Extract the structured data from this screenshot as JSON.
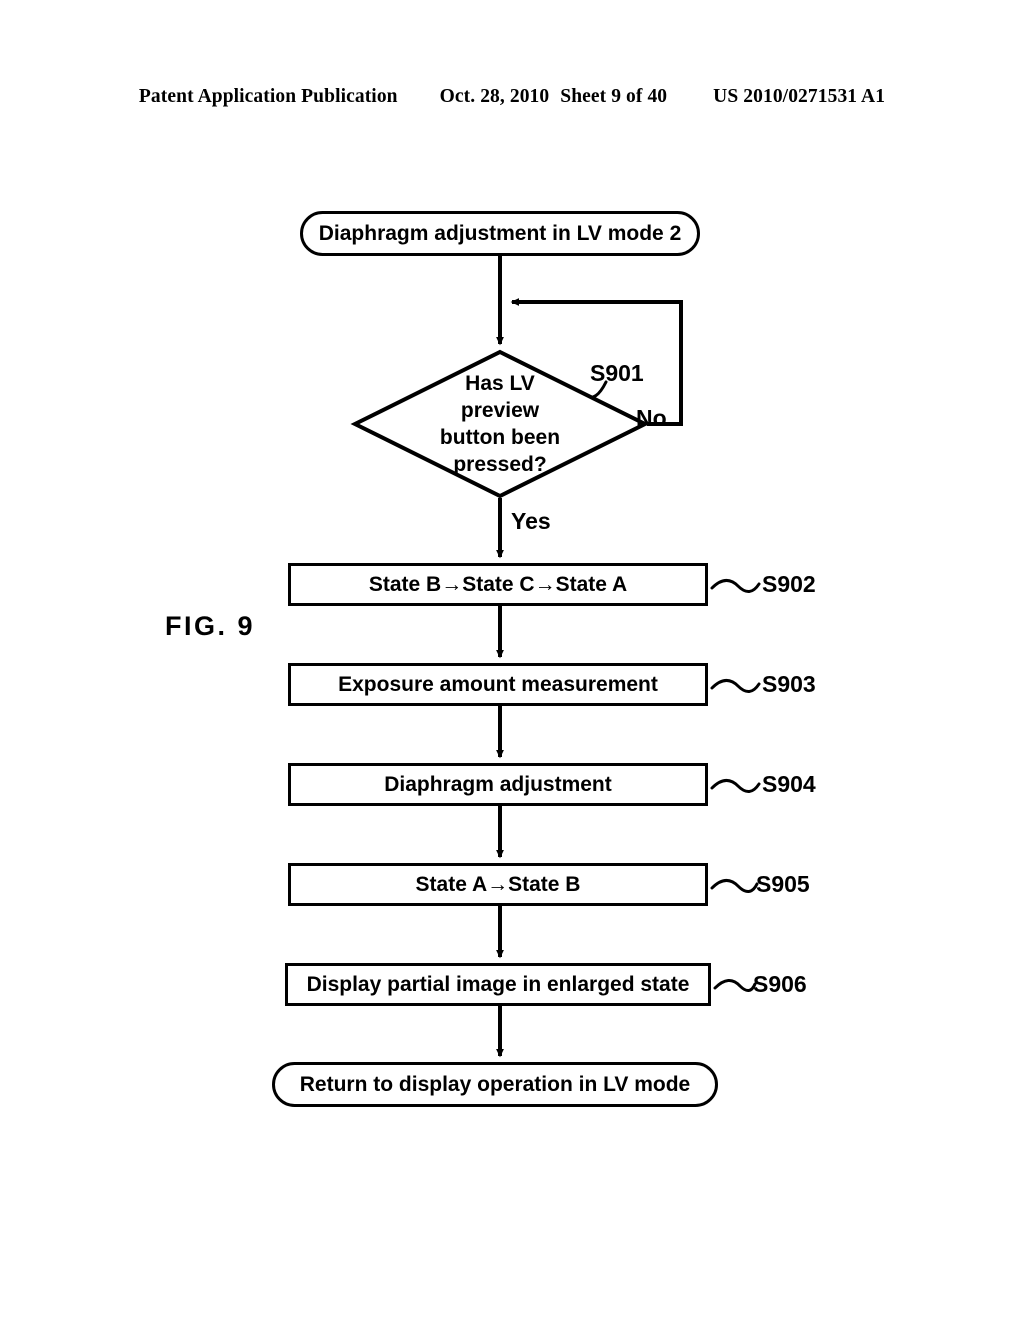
{
  "header": {
    "publication": "Patent Application Publication",
    "date": "Oct. 28, 2010",
    "sheet": "Sheet 9 of 40",
    "patent_number": "US 2010/0271531 A1"
  },
  "figure": {
    "label": "FIG. 9"
  },
  "flowchart": {
    "start": {
      "label": "Diaphragm adjustment in LV mode 2"
    },
    "decision": {
      "label": "Has LV\npreview\nbutton been\npressed?",
      "line1": "Has LV",
      "line2": "preview",
      "line3": "button been",
      "line4": "pressed?",
      "ref": "S901",
      "yes_label": "Yes",
      "no_label": "No"
    },
    "steps": [
      {
        "ref": "S902",
        "label": "State B→State C→State A"
      },
      {
        "ref": "S903",
        "label": "Exposure amount measurement"
      },
      {
        "ref": "S904",
        "label": "Diaphragm adjustment"
      },
      {
        "ref": "S905",
        "label": "State A→State B"
      },
      {
        "ref": "S906",
        "label": "Display partial image in enlarged state"
      }
    ],
    "end": {
      "label": "Return to display operation in LV mode"
    }
  },
  "colors": {
    "ink": "#000000",
    "paper": "#ffffff"
  }
}
